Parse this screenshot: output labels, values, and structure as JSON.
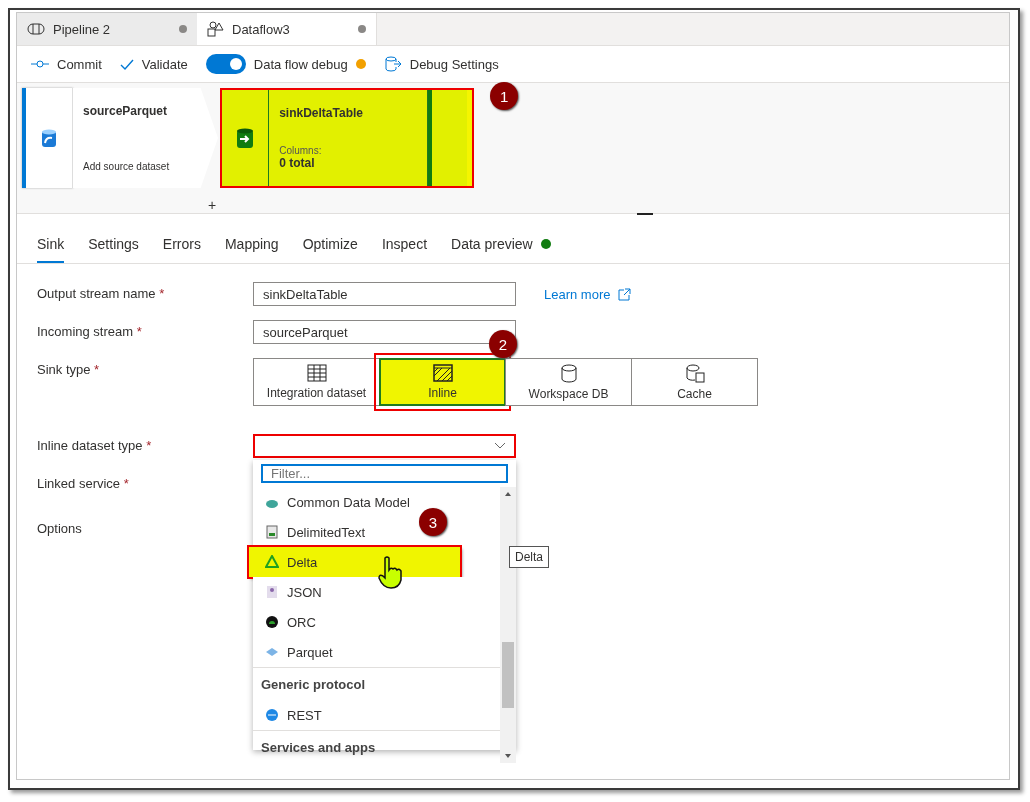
{
  "tabs": [
    {
      "label": "Pipeline 2",
      "kind": "pipeline",
      "selected": false,
      "unsaved": true
    },
    {
      "label": "Dataflow3",
      "kind": "dataflow",
      "selected": true,
      "unsaved": true
    }
  ],
  "toolbar": {
    "commit": "Commit",
    "validate": "Validate",
    "debug_label": "Data flow debug",
    "debug_on": true,
    "debug_settings": "Debug Settings"
  },
  "canvas": {
    "nodes": [
      {
        "kind": "source",
        "name": "sourceParquet",
        "subtitle": "Add source dataset"
      },
      {
        "kind": "sink",
        "name": "sinkDeltaTable",
        "columns_label": "Columns:",
        "columns_value": "0 total",
        "highlighted": true,
        "callout": "1"
      }
    ],
    "add_symbol": "+"
  },
  "panel_tabs": [
    {
      "label": "Sink",
      "selected": true
    },
    {
      "label": "Settings",
      "selected": false
    },
    {
      "label": "Errors",
      "selected": false
    },
    {
      "label": "Mapping",
      "selected": false
    },
    {
      "label": "Optimize",
      "selected": false
    },
    {
      "label": "Inspect",
      "selected": false
    },
    {
      "label": "Data preview",
      "selected": false,
      "status_dot": true
    }
  ],
  "form": {
    "output_stream": {
      "label": "Output stream name",
      "required_mark": "*",
      "value": "sinkDeltaTable"
    },
    "learn_more": "Learn more",
    "incoming_stream": {
      "label": "Incoming stream",
      "required_mark": "*",
      "value": "sourceParquet"
    },
    "sink_type": {
      "label": "Sink type",
      "required_mark": "*",
      "callout": "2",
      "options": [
        {
          "label": "Integration dataset",
          "kind": "dataset",
          "selected": false,
          "highlighted": false
        },
        {
          "label": "Inline",
          "kind": "inline",
          "selected": true,
          "highlighted": true
        },
        {
          "label": "Workspace DB",
          "kind": "workspace",
          "selected": false,
          "highlighted": false
        },
        {
          "label": "Cache",
          "kind": "cache",
          "selected": false,
          "highlighted": false
        }
      ]
    },
    "inline_dataset_type": {
      "label": "Inline dataset type",
      "required_mark": "*",
      "invalid": true,
      "expanded": true
    },
    "linked_service": {
      "label": "Linked service",
      "required_mark": "*"
    },
    "options": {
      "label": "Options"
    }
  },
  "dropdown": {
    "filter_placeholder": "Filter...",
    "callout": "3",
    "tooltip": "Delta",
    "items": [
      {
        "kind": "item",
        "label": "Common Data Model",
        "highlighted": false
      },
      {
        "kind": "item",
        "label": "DelimitedText",
        "highlighted": false
      },
      {
        "kind": "item",
        "label": "Delta",
        "highlighted": true
      },
      {
        "kind": "item",
        "label": "JSON",
        "highlighted": false
      },
      {
        "kind": "item",
        "label": "ORC",
        "highlighted": false
      },
      {
        "kind": "item",
        "label": "Parquet",
        "highlighted": false
      },
      {
        "kind": "header",
        "label": "Generic protocol"
      },
      {
        "kind": "item",
        "label": "REST",
        "highlighted": false
      },
      {
        "kind": "header",
        "label": "Services and apps"
      }
    ]
  }
}
